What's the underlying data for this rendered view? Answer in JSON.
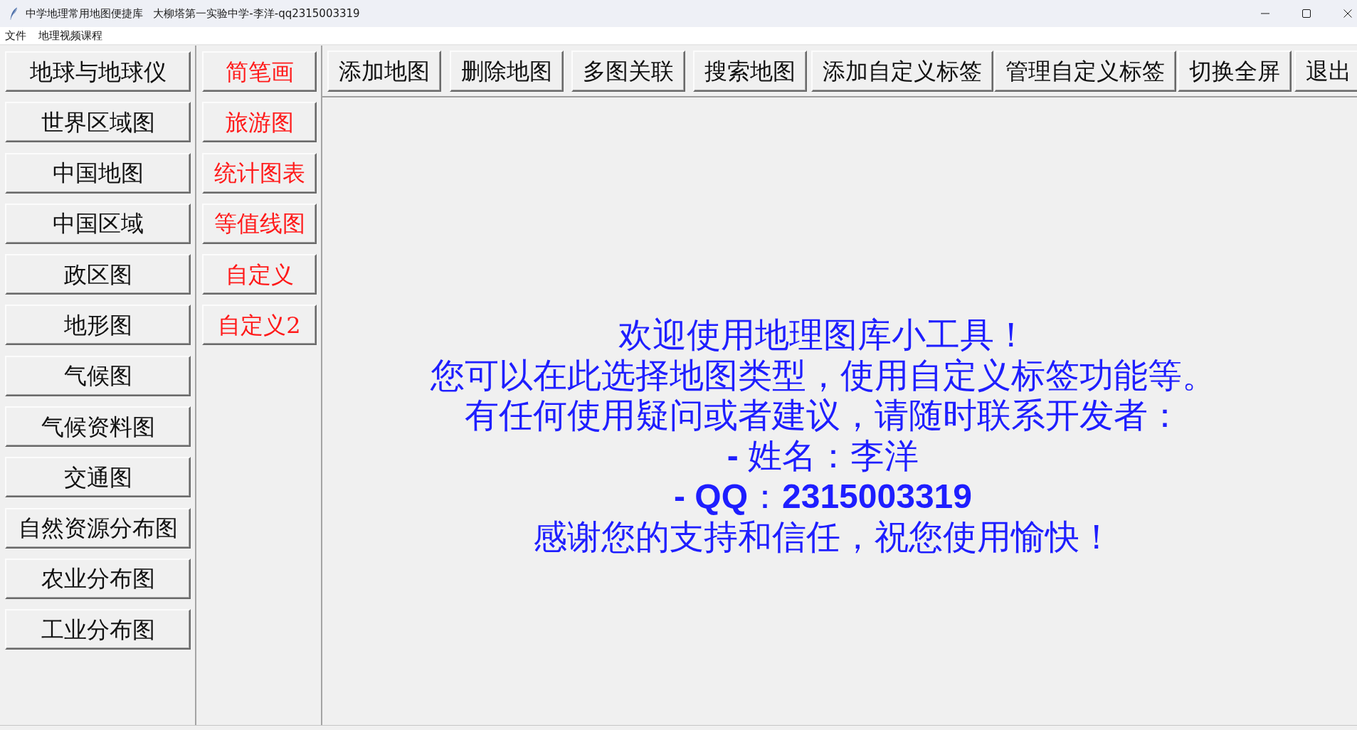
{
  "window": {
    "title": "中学地理常用地图便捷库   大柳塔第一实验中学-李洋-qq2315003319"
  },
  "menu_bar": [
    "文件",
    "地理视频课程"
  ],
  "map_categories": [
    "地球与地球仪",
    "世界区域图",
    "中国地图",
    "中国区域",
    "政区图",
    "地形图",
    "气候图",
    "气候资料图",
    "交通图",
    "自然资源分布图",
    "农业分布图",
    "工业分布图"
  ],
  "map_styles": [
    "简笔画",
    "旅游图",
    "统计图表",
    "等值线图",
    "自定义",
    "自定义2"
  ],
  "toolbar": [
    "添加地图",
    "删除地图",
    "多图关联",
    "搜索地图",
    "添加自定义标签",
    "管理自定义标签",
    "切换全屏",
    "退出"
  ],
  "welcome_message": [
    "欢迎使用地理图库小工具！",
    "您可以在此选择地图类型，使用自定义标签功能等。",
    "有任何使用疑问或者建议，请随时联系开发者：",
    "**-** 姓名：李洋",
    "**- QQ**：**2315003319**",
    "感谢您的支持和信任，祝您使用愉快！"
  ]
}
